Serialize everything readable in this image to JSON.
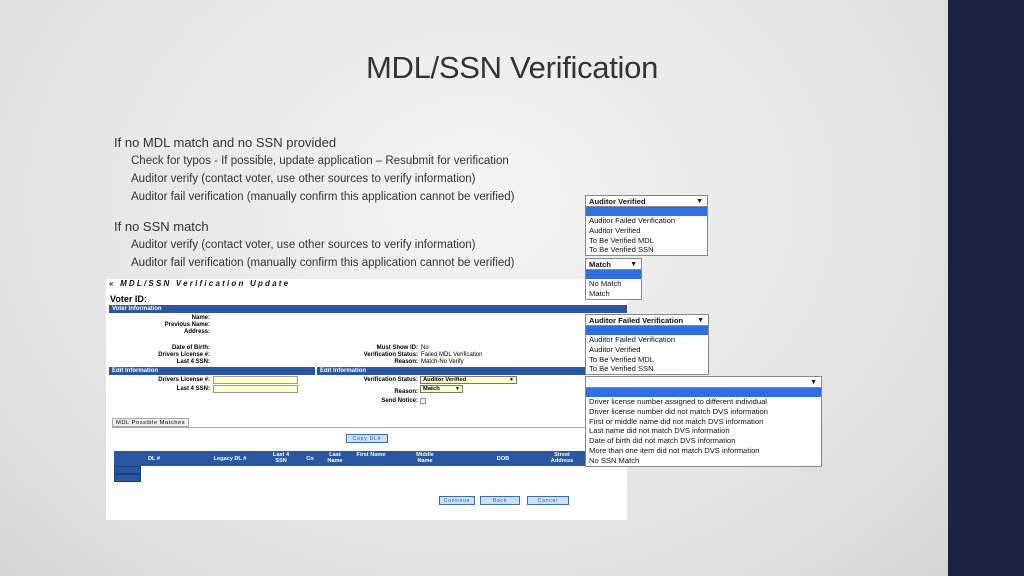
{
  "slide": {
    "title": "MDL/SSN Verification",
    "sections": [
      {
        "heading": "If no MDL match and no SSN provided",
        "items": [
          "Check for typos - If possible, update application – Resubmit for verification",
          "Auditor verify (contact voter, use other sources to verify information)",
          "Auditor fail verification (manually confirm this application cannot be verified)"
        ]
      },
      {
        "heading": "If no SSN match",
        "items": [
          "Auditor verify (contact voter, use other sources to verify information)",
          "Auditor fail verification (manually confirm this application cannot be verified)"
        ]
      }
    ]
  },
  "form": {
    "header": "« MDL/SSN Verification Update",
    "voter_id_label": "Voter ID:",
    "voter_info_bar": "Voter Information",
    "labels": {
      "name": "Name:",
      "previous_name": "Previous Name:",
      "address": "Address:",
      "dob": "Date of Birth:",
      "dl": "Drivers License #:",
      "ssn": "Last 4 SSN:",
      "must_show_id": "Must Show ID:",
      "verification_status": "Verification Status:",
      "reason": "Reason:"
    },
    "values": {
      "must_show_id": "No",
      "verification_status": "Failed MDL Verification",
      "reason": "Match-No Verify"
    },
    "edit_bar_left": "Edit Information",
    "edit_bar_right": "Edit Information",
    "edit_labels": {
      "dl": "Drivers License #:",
      "ssn": "Last 4 SSN:",
      "verification_status": "Verification Status:",
      "reason": "Reason:",
      "send_notice": "Send Notice:"
    },
    "status_select": "Auditor Verified",
    "reason_select": "Match",
    "matches_tab": "MDL Possible Matches",
    "copy_button": "Copy DL#",
    "columns": [
      "DL #",
      "Legacy DL #",
      "Last 4 SSN",
      "Co",
      "Last Name",
      "First Name",
      "Middle Name",
      "DOB",
      "Street Address"
    ],
    "buttons": {
      "continue": "Continue",
      "back": "Back",
      "cancel": "Cancel"
    }
  },
  "dropdowns": {
    "dd1": {
      "selected": "Auditor Verified",
      "options": [
        "Auditor Failed Verification",
        "Auditor Verified",
        "To Be Verified MDL",
        "To Be Verified SSN"
      ]
    },
    "dd2": {
      "selected": "Match",
      "options": [
        "No Match",
        "Match"
      ]
    },
    "dd3": {
      "selected": "Auditor Failed Verification",
      "options": [
        "Auditor Failed Verification",
        "Auditor Verified",
        "To Be Verified MDL",
        "To Be Verified SSN"
      ]
    },
    "dd4": {
      "selected": "",
      "options": [
        "Driver license number assigned to different individual",
        "Driver license number did not match DVS information",
        "First or middle name did not match DVS information",
        "Last name did not match DVS information",
        "Date of birth did not match DVS information",
        "More than one item did not match DVS information",
        "No SSN Match"
      ]
    }
  },
  "colors": {
    "sidebar": "#1c2140",
    "accent": "#2a57a0",
    "highlight": "#2f6fe0",
    "field": "#ffffcc"
  },
  "icons": {
    "dropdown_arrow": "▼"
  }
}
